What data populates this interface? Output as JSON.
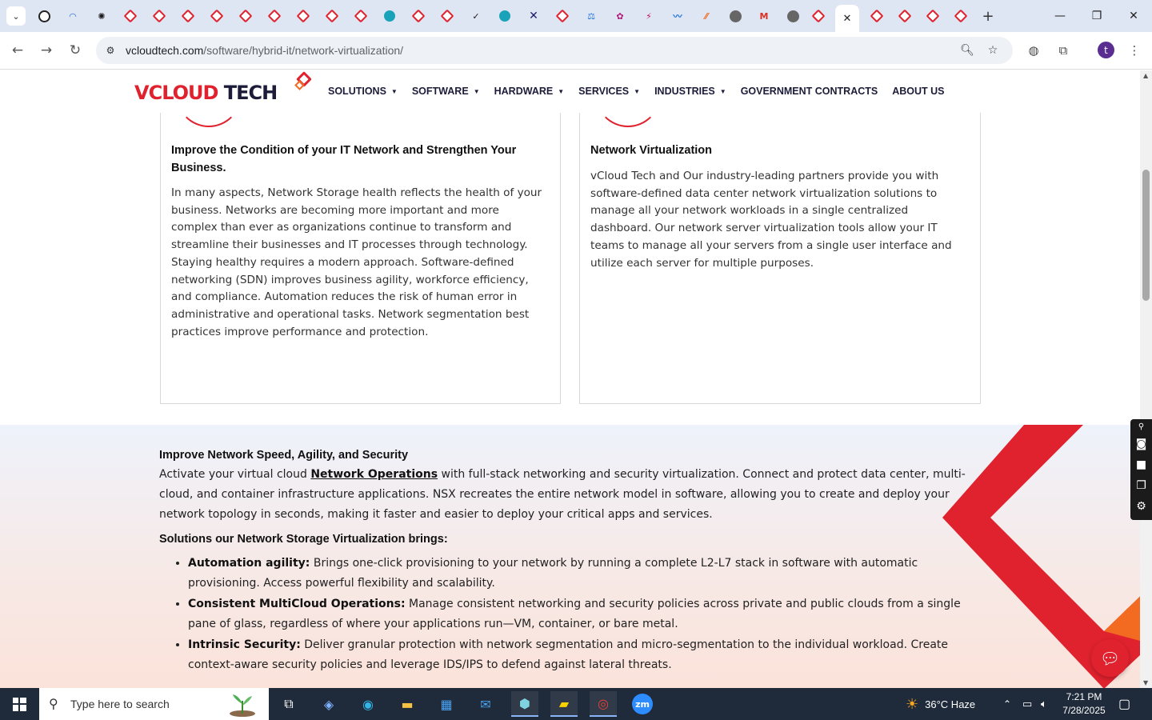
{
  "browser": {
    "tabs": [
      {
        "icon": "dark-circle-icon"
      },
      {
        "icon": "wave-icon"
      },
      {
        "icon": "openai-icon"
      },
      {
        "icon": "diamond-icon"
      },
      {
        "icon": "diamond-icon"
      },
      {
        "icon": "diamond-icon"
      },
      {
        "icon": "diamond-icon"
      },
      {
        "icon": "diamond-icon"
      },
      {
        "icon": "diamond-icon"
      },
      {
        "icon": "diamond-icon"
      },
      {
        "icon": "diamond-icon"
      },
      {
        "icon": "diamond-icon"
      },
      {
        "icon": "hexagon-icon"
      },
      {
        "icon": "diamond-icon"
      },
      {
        "icon": "diamond-icon"
      },
      {
        "icon": "checkmark-icon"
      },
      {
        "icon": "hexagon-icon"
      },
      {
        "icon": "x-cross-icon"
      },
      {
        "icon": "diamond-icon"
      },
      {
        "icon": "scales-icon"
      },
      {
        "icon": "puzzle-icon"
      },
      {
        "icon": "bolt-icon"
      },
      {
        "icon": "pulse-icon"
      },
      {
        "icon": "slash-icon"
      },
      {
        "icon": "globe-icon"
      },
      {
        "icon": "gmail-icon"
      },
      {
        "icon": "globe-icon"
      },
      {
        "icon": "diamond-icon"
      },
      {
        "icon": "close-icon"
      },
      {
        "icon": "diamond-icon"
      },
      {
        "icon": "diamond-icon"
      },
      {
        "icon": "diamond-icon"
      },
      {
        "icon": "diamond-icon"
      }
    ],
    "url_host": "vcloudtech.com",
    "url_path": "/software/hybrid-it/network-virtualization/",
    "profile_initial": "t"
  },
  "site": {
    "logo_main": "VCLOUD",
    "logo_tech": " TECH",
    "nav": [
      {
        "label": "SOLUTIONS",
        "dropdown": true
      },
      {
        "label": "SOFTWARE",
        "dropdown": true
      },
      {
        "label": "HARDWARE",
        "dropdown": true
      },
      {
        "label": "SERVICES",
        "dropdown": true
      },
      {
        "label": "INDUSTRIES",
        "dropdown": true
      },
      {
        "label": "GOVERNMENT CONTRACTS",
        "dropdown": false
      },
      {
        "label": "ABOUT US",
        "dropdown": false
      }
    ]
  },
  "cards": [
    {
      "title": "Improve the Condition of your IT Network and Strengthen Your Business.",
      "body": "In many aspects, Network Storage health reflects the health of your business. Networks are becoming more important and more complex than ever as organizations continue to transform and streamline their businesses and IT processes through technology. Staying healthy requires a modern approach. Software-defined networking (SDN) improves business agility, workforce efficiency, and compliance. Automation reduces the risk of human error in administrative and operational tasks. Network segmentation best practices improve performance and protection."
    },
    {
      "title": "Network Virtualization",
      "body": "vCloud Tech and Our industry-leading partners provide you with software-defined data center network virtualization solutions to manage all your network workloads in a single centralized dashboard. Our network server virtualization tools allow your IT teams to manage all your servers from a single user interface and utilize each server for multiple purposes."
    }
  ],
  "section": {
    "heading": "Improve Network Speed, Agility, and Security",
    "intro_before": " Activate your virtual cloud ",
    "intro_link": "Network Operations",
    "intro_after": " with full-stack networking and security virtualization. Connect and protect data center, multi-cloud, and container infrastructure applications. NSX recreates the entire network model in software, allowing you to create and deploy your network topology in seconds, making it faster and easier to deploy your critical apps and services.",
    "subheading": "Solutions our Network Storage Virtualization brings:",
    "bullets": [
      {
        "term": "Automation agility:",
        "text": " Brings one-click provisioning to your network by running a complete L2-L7 stack in software with automatic provisioning. Access powerful flexibility and scalability."
      },
      {
        "term": "Consistent MultiCloud Operations:",
        "text": " Manage consistent networking and security policies across private and public clouds from a single pane of glass, regardless of where your applications run—VM, container, or bare metal."
      },
      {
        "term": "Intrinsic Security:",
        "text": " Deliver granular protection with network segmentation and micro-segmentation to the individual workload. Create context-aware security policies and leverage IDS/IPS to defend against lateral threats."
      }
    ]
  },
  "taskbar": {
    "search_placeholder": "Type here to search",
    "weather": "36°C  Haze",
    "time": "7:21 PM",
    "date": "7/28/2025"
  },
  "colors": {
    "brand_red": "#e0222e",
    "brand_navy": "#1c1c3a",
    "brand_orange": "#f26b21"
  }
}
